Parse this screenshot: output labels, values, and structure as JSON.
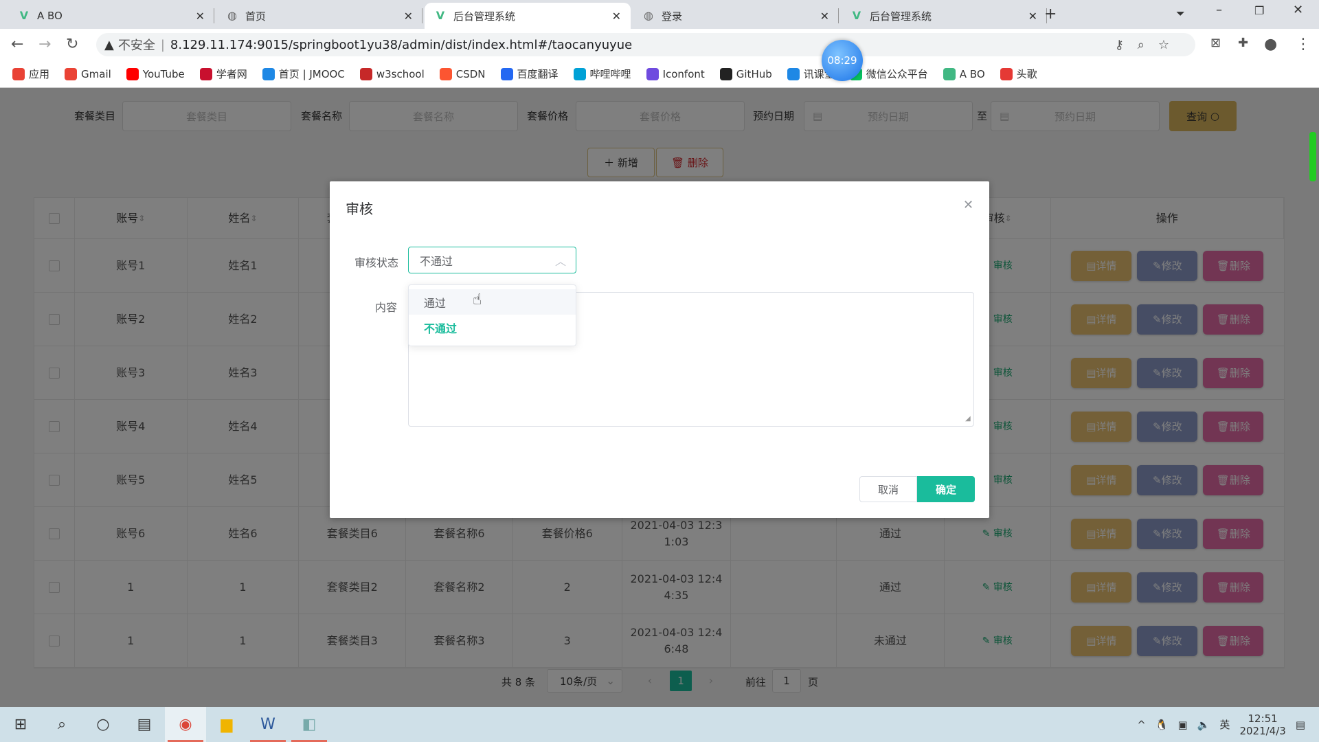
{
  "browser": {
    "tabs": [
      {
        "title": "A BO",
        "icon": "vue-icon"
      },
      {
        "title": "首页",
        "icon": "globe-icon"
      },
      {
        "title": "后台管理系统",
        "icon": "vue-icon",
        "active": true
      },
      {
        "title": "登录",
        "icon": "globe-icon"
      },
      {
        "title": "后台管理系统",
        "icon": "vue-icon"
      }
    ],
    "security": "不安全",
    "url": "8.129.11.174:9015/springboot1yu38/admin/dist/index.html#/taocanyuyue",
    "clock": "08:29",
    "bookmarks": [
      {
        "label": "应用",
        "color": "#e94235"
      },
      {
        "label": "Gmail",
        "color": "#ea4335"
      },
      {
        "label": "YouTube",
        "color": "#ff0000"
      },
      {
        "label": "学者网",
        "color": "#c8102e"
      },
      {
        "label": "首页 | JMOOC",
        "color": "#1e88e5"
      },
      {
        "label": "w3school",
        "color": "#c62828"
      },
      {
        "label": "CSDN",
        "color": "#fc5531"
      },
      {
        "label": "百度翻译",
        "color": "#2468f2"
      },
      {
        "label": "哔哩哔哩",
        "color": "#00a1d6"
      },
      {
        "label": "Iconfont",
        "color": "#6f4bdf"
      },
      {
        "label": "GitHub",
        "color": "#222"
      },
      {
        "label": "讯课堂",
        "color": "#1e88e5"
      },
      {
        "label": "微信公众平台",
        "color": "#07c160"
      },
      {
        "label": "A BO",
        "color": "#41b883"
      },
      {
        "label": "头歌",
        "color": "#e53935"
      }
    ]
  },
  "search": {
    "fields": [
      {
        "label": "套餐类目",
        "placeholder": "套餐类目"
      },
      {
        "label": "套餐名称",
        "placeholder": "套餐名称"
      },
      {
        "label": "套餐价格",
        "placeholder": "套餐价格"
      },
      {
        "label": "预约日期",
        "placeholder": "预约日期"
      },
      {
        "label": "至",
        "placeholder": "预约日期"
      }
    ],
    "query": "查询"
  },
  "toolbar": {
    "add": "新增",
    "delete": "删除"
  },
  "table": {
    "headers": [
      "账号",
      "姓名",
      "套餐类目",
      "",
      "",
      "",
      "",
      "",
      "审核",
      "操作"
    ],
    "audit_link": "审核",
    "actions": {
      "detail": "详情",
      "edit": "修改",
      "delete": "删除"
    },
    "rows": [
      [
        "账号1",
        "姓名1",
        "",
        "",
        "",
        "",
        "",
        ""
      ],
      [
        "账号2",
        "姓名2",
        "",
        "",
        "",
        "",
        "",
        ""
      ],
      [
        "账号3",
        "姓名3",
        "",
        "",
        "",
        "",
        "",
        ""
      ],
      [
        "账号4",
        "姓名4",
        "",
        "",
        "",
        "",
        "",
        ""
      ],
      [
        "账号5",
        "姓名5",
        "",
        "",
        "",
        "",
        "",
        ""
      ],
      [
        "账号6",
        "姓名6",
        "套餐类目6",
        "套餐名称6",
        "套餐价格6",
        "2021-04-03 12:3\n1:03",
        "",
        "通过"
      ],
      [
        "1",
        "1",
        "套餐类目2",
        "套餐名称2",
        "2",
        "2021-04-03 12:4\n4:35",
        "",
        "通过"
      ],
      [
        "1",
        "1",
        "套餐类目3",
        "套餐名称3",
        "3",
        "2021-04-03 12:4\n6:48",
        "",
        "未通过"
      ]
    ]
  },
  "pagination": {
    "total": "共 8 条",
    "page_size": "10条/页",
    "current": "1",
    "goto": "前往",
    "goto_value": "1",
    "page_unit": "页"
  },
  "modal": {
    "title": "审核",
    "status_label": "审核状态",
    "status_value": "不通过",
    "content_label": "内容",
    "content_value": "",
    "options": [
      "通过",
      "不通过"
    ],
    "cancel": "取消",
    "confirm": "确定"
  },
  "taskbar": {
    "time": "12:51",
    "date": "2021/4/3",
    "ime": "英"
  },
  "colors": {
    "accent": "#1abc9c",
    "detail": "#e8c070",
    "edit": "#8c9bc8",
    "delete": "#e46aa6",
    "query": "#d9b45c",
    "audit": "#18a870"
  }
}
